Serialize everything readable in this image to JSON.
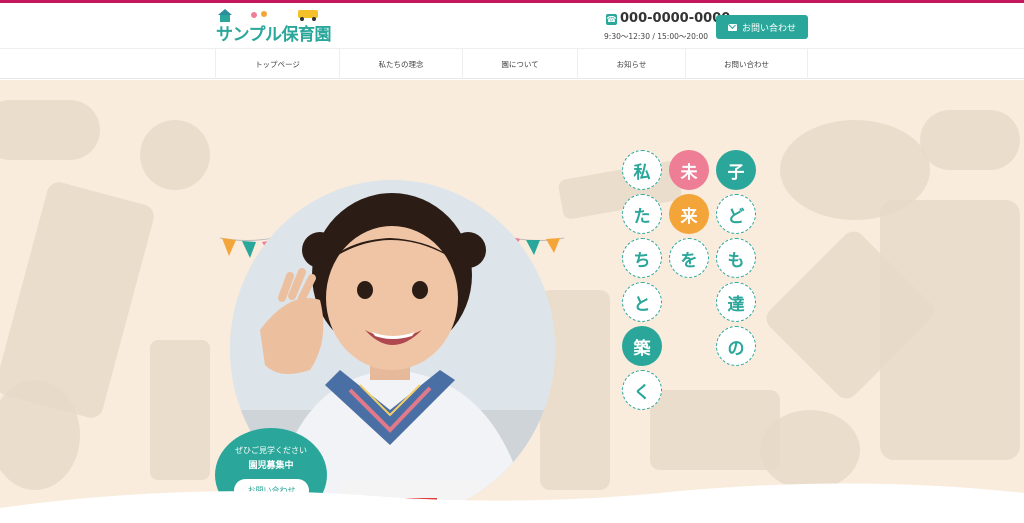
{
  "header": {
    "logo_text": "サンプル保育園",
    "phone_number": "000-0000-0000",
    "phone_hours": "9:30〜12:30 / 15:00〜20:00",
    "contact_button": "お問い合わせ"
  },
  "nav": {
    "items": [
      {
        "label": "トップページ"
      },
      {
        "label": "私たちの理念"
      },
      {
        "label": "園について"
      },
      {
        "label": "お知らせ"
      },
      {
        "label": "お問い合わせ"
      }
    ]
  },
  "hero": {
    "badge_line1": "ぜひご見学ください",
    "badge_line2": "園児募集中",
    "badge_button": "お問い合わせ",
    "tagline_col1": [
      "子",
      "ど",
      "も",
      "達",
      "の"
    ],
    "tagline_col2": [
      "未",
      "来",
      "を"
    ],
    "tagline_col3": [
      "私",
      "た",
      "ち",
      "と",
      "築",
      "く"
    ]
  },
  "colors": {
    "accent": "#2aa79a",
    "pink": "#ee7d96",
    "orange": "#f4a53a",
    "background": "#f9ecdc",
    "topline": "#c2185b"
  }
}
